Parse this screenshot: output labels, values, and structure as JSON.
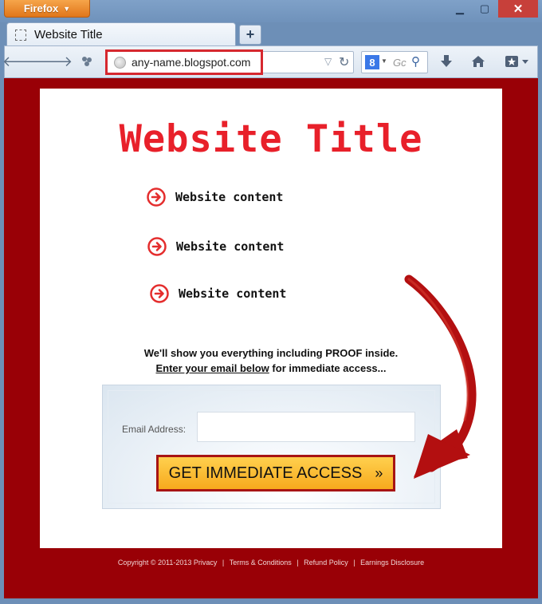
{
  "browser": {
    "app_button": "Firefox",
    "tab_title": "Website Title",
    "new_tab": "+",
    "url": "any-name.blogspot.com",
    "search_placeholder": "Gc",
    "search_engine_letter": "8"
  },
  "page": {
    "title": "Website Title",
    "bullets": [
      "Website content",
      "Website content",
      "Website content"
    ],
    "pitch_line1": "We'll show you everything including PROOF inside.",
    "pitch_link": "Enter your email below",
    "pitch_rest": " for immediate access...",
    "email_label": "Email Address:",
    "email_value": "",
    "cta_label": "GET IMMEDIATE ACCESS",
    "cta_chevron": "»"
  },
  "footer": {
    "items": [
      "Copyright © 2011-2013 Privacy",
      "Terms & Conditions",
      "Refund Policy",
      "Earnings Disclosure"
    ],
    "separator": "|"
  },
  "colors": {
    "page_background": "#990006",
    "title_red": "#e8202a",
    "cta_yellow": "#f7a91d",
    "firefox_orange": "#e0761a"
  }
}
